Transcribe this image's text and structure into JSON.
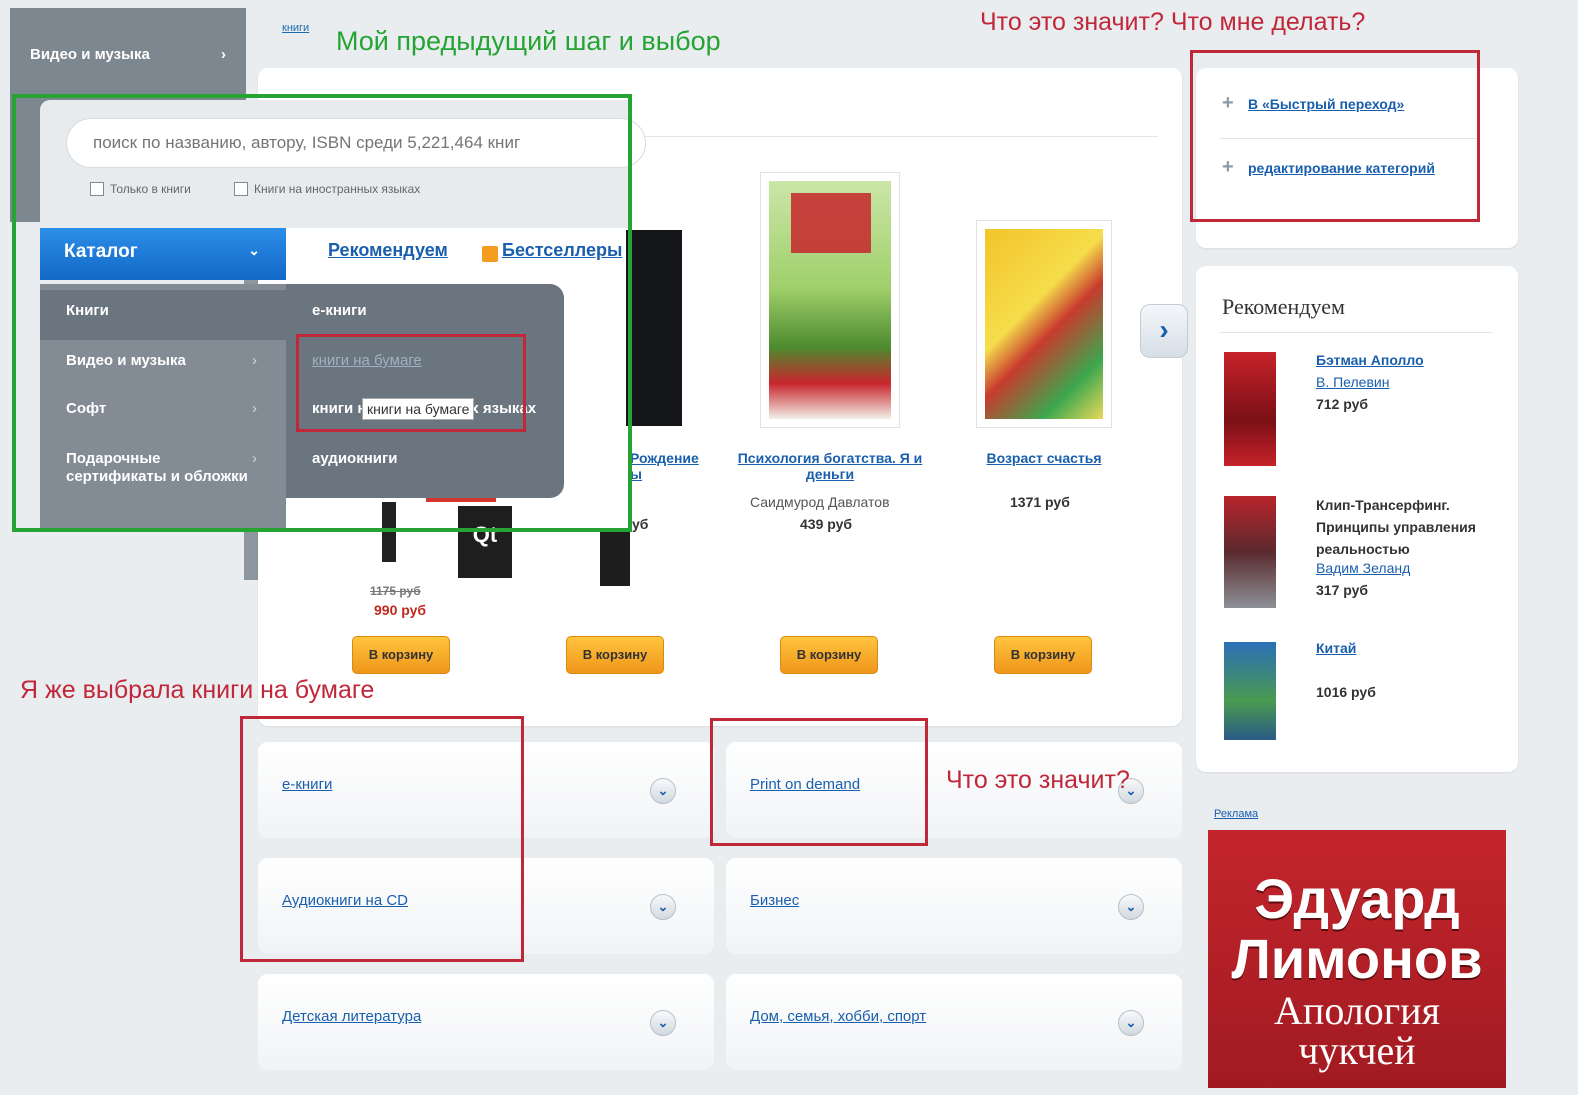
{
  "sidebar_left": {
    "top_item": "Видео и музыка"
  },
  "breadcrumb": "книги",
  "search": {
    "placeholder": "поиск по названию, автору, ISBN среди 5,221,464 книг",
    "checkbox_only_books": "Только в книги",
    "checkbox_foreign": "Книги на иностранных языках"
  },
  "catalog": {
    "button": "Каталог",
    "menu_left": [
      "Книги",
      "Видео и музыка",
      "Софт",
      "Подарочные сертификаты и обложки"
    ],
    "menu_right": [
      "е-книги",
      "книги на бумаге",
      "книги на иностранных языках",
      "аудиокниги"
    ],
    "tooltip": "книги на бумаге"
  },
  "tabs": {
    "recommend": "Рекомендуем",
    "bestsellers": "Бестселлеры"
  },
  "books": [
    {
      "title": "",
      "author": "",
      "price_old": "1175 руб",
      "price": "990 руб",
      "cart": "В корзину"
    },
    {
      "title": "Рождение ы",
      "author": "",
      "price": "уб",
      "cart": "В корзину"
    },
    {
      "title": "Психология богатства. Я и деньги",
      "author": "Саидмурод Давлатов",
      "price": "439 руб",
      "cart": "В корзину"
    },
    {
      "title": "Возраст счастья",
      "author": "",
      "price": "1371 руб",
      "cart": "В корзину"
    }
  ],
  "categories": [
    "е-книги",
    "Print on demand",
    "Аудиокниги на CD",
    "Бизнес",
    "Детская литература",
    "Дом, семья, хобби, спорт"
  ],
  "quick_actions": {
    "quick_jump": "В «Быстрый переход»",
    "edit_categories": "редактирование категорий"
  },
  "recommend_sidebar": {
    "title": "Рекомендуем",
    "items": [
      {
        "title": "Бэтман Аполло",
        "author": "В. Пелевин",
        "price": "712 руб"
      },
      {
        "title": "Клип-Трансерфинг. Принципы управления реальностью",
        "author": "Вадим Зеланд",
        "price": "317 руб"
      },
      {
        "title": "Китай",
        "author": "",
        "price": "1016 руб"
      }
    ]
  },
  "ad": {
    "label": "Реклама",
    "author_first": "Эдуард",
    "author_last": "Лимонов",
    "book_line1": "Апология",
    "book_line2": "чукчей"
  },
  "annotations": {
    "prev_step": "Мой предыдущий шаг и выбор",
    "what_means_top": "Что это значит? Что мне делать?",
    "chose_paper": "Я же выбрала книги на бумаге",
    "what_means": "Что это значит?"
  },
  "colors": {
    "annotation_red": "#c0283a",
    "annotation_green": "#25a433",
    "link_blue": "#1a5fad",
    "cart_orange": "#f0961b"
  }
}
